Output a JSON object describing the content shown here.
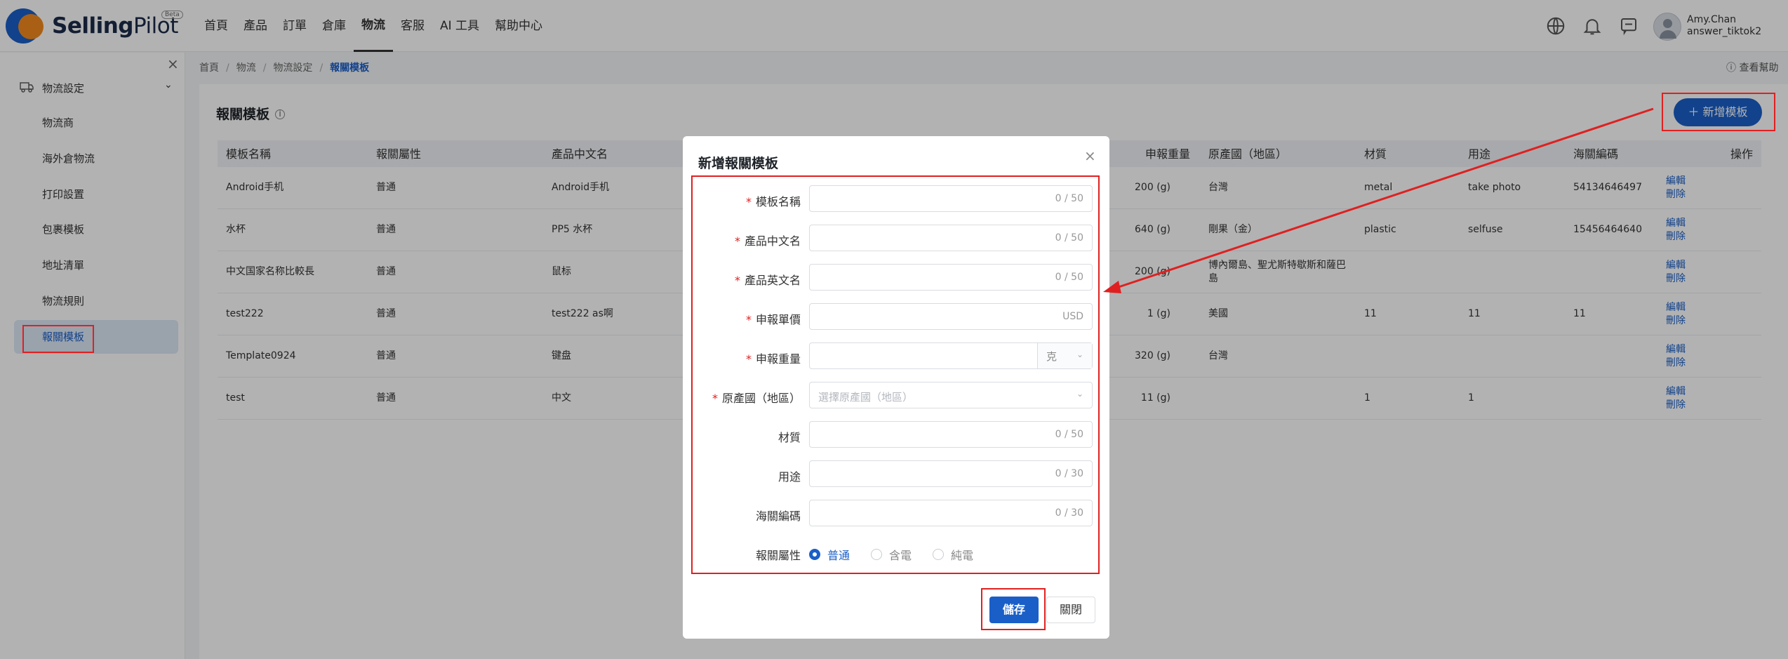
{
  "logo": {
    "text_a": "Selling",
    "text_b": "Pilot",
    "badge": "Beta"
  },
  "nav": [
    "首頁",
    "產品",
    "訂單",
    "倉庫",
    "物流",
    "客服",
    "AI 工具",
    "幫助中心"
  ],
  "user": {
    "line1": "Amy.Chan",
    "line2": "answer_tiktok2"
  },
  "sidebar": {
    "group": "物流設定",
    "items": [
      "物流商",
      "海外倉物流",
      "打印設置",
      "包裹模板",
      "地址清單",
      "物流規則",
      "報關模板"
    ]
  },
  "breadcrumb": [
    "首頁",
    "物流",
    "物流設定",
    "報關模板"
  ],
  "help": "查看幫助",
  "page_title": "報關模板",
  "add_button": "新增模板",
  "table": {
    "headers": [
      "模板名稱",
      "報關屬性",
      "產品中文名",
      "申報重量",
      "原產國（地區）",
      "材質",
      "用途",
      "海關編碼",
      "操作"
    ],
    "edit": "編輯",
    "delete": "刪除",
    "rows": [
      [
        "Android手机",
        "普通",
        "Android手机",
        "200 (g)",
        "台灣",
        "metal",
        "take photo",
        "54134646497"
      ],
      [
        "水杯",
        "普通",
        "PP5 水杯",
        "640 (g)",
        "剛果（金）",
        "plastic",
        "selfuse",
        "15456464640"
      ],
      [
        "中文国家名称比較長",
        "普通",
        "鼠标",
        "200 (g)",
        "博內爾島、聖尤斯特歇斯和薩巴島",
        "",
        "",
        ""
      ],
      [
        "test222",
        "普通",
        "test222 as啊",
        "1 (g)",
        "美國",
        "11",
        "11",
        "11"
      ],
      [
        "Template0924",
        "普通",
        "键盘",
        "320 (g)",
        "台灣",
        "",
        "",
        ""
      ],
      [
        "test",
        "普通",
        "中文",
        "11 (g)",
        "",
        "1",
        "1",
        ""
      ]
    ]
  },
  "modal": {
    "title": "新增報關模板",
    "fields": {
      "name": {
        "label": "模板名稱",
        "count": "0 / 50"
      },
      "cn_name": {
        "label": "產品中文名",
        "count": "0 / 50"
      },
      "en_name": {
        "label": "產品英文名",
        "count": "0 / 50"
      },
      "price": {
        "label": "申報單價",
        "suffix": "USD"
      },
      "weight": {
        "label": "申報重量",
        "unit": "克"
      },
      "origin": {
        "label": "原產國（地區）",
        "placeholder": "選擇原產國（地區）"
      },
      "material": {
        "label": "材質",
        "count": "0 / 50"
      },
      "usage": {
        "label": "用途",
        "count": "0 / 30"
      },
      "hs_code": {
        "label": "海關編碼",
        "count": "0 / 30"
      },
      "attr": {
        "label": "報關屬性",
        "options": [
          "普通",
          "含電",
          "純電"
        ],
        "selected": "普通"
      }
    },
    "save": "儲存",
    "close": "關閉"
  },
  "colors": {
    "accent": "#1a5fc8",
    "highlight": "#e02020"
  }
}
